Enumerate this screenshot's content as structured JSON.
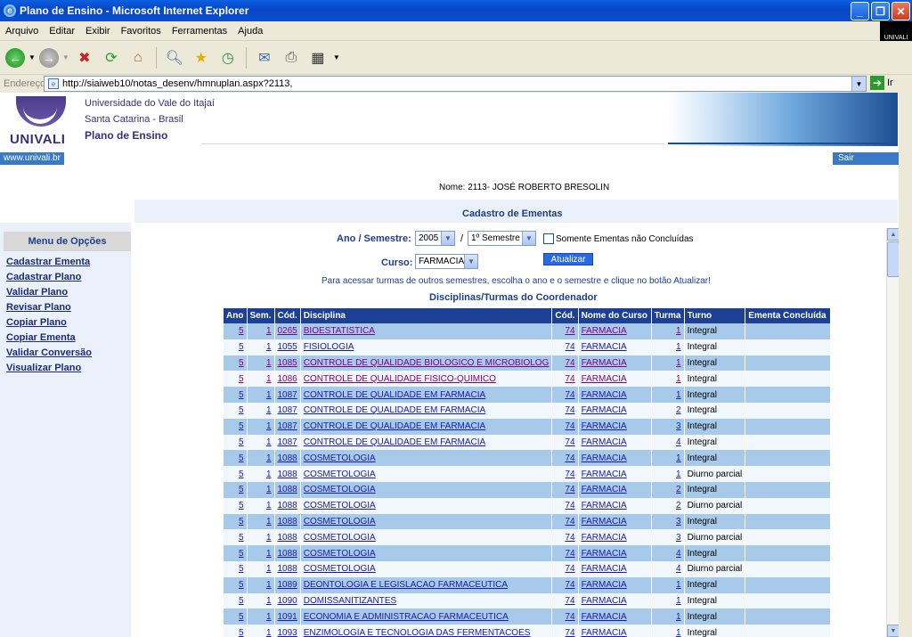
{
  "window": {
    "title": "Plano de Ensino - Microsoft Internet Explorer",
    "min": "_",
    "max": "❐",
    "close": "✕"
  },
  "menubar": [
    "Arquivo",
    "Editar",
    "Exibir",
    "Favoritos",
    "Ferramentas",
    "Ajuda"
  ],
  "windows_logo_text": "UNIVALI",
  "address": {
    "label": "Endereço",
    "url": "http://siaiweb10/notas_desenv/hmnuplan.aspx?2113,",
    "go_label": "Ir"
  },
  "header": {
    "logo_text": "UNIVALI",
    "university": "Universidade do Vale do Itajaí",
    "location": "Santa Catarina - Brasil",
    "title": "Plano de Ensino",
    "site_link": "www.univali.br",
    "logout": "Sair"
  },
  "user_name": "Nome: 2113- JOSÉ ROBERTO BRESOLIN",
  "section_title": "Cadastro de Ementas",
  "sidebar": {
    "heading": "Menu de Opções",
    "items": [
      "Cadastrar Ementa",
      "Cadastrar Plano",
      "Validar Plano",
      "Revisar Plano",
      "Copiar Plano",
      "Copiar Ementa",
      "Validar Conversão",
      "Visualizar Plano"
    ]
  },
  "form": {
    "year_sem_label": "Ano / Semestre:",
    "year": "2005",
    "separator": "/",
    "semester": "1º Semestre",
    "only_pending_label": "Somente Ementas não Concluídas",
    "course_label": "Curso:",
    "course": "FARMACIA",
    "update_button": "Atualizar",
    "help_text": "Para acessar turmas de outros semestres, escolha o ano e o semestre e clique no botão Atualizar!"
  },
  "table": {
    "title": "Disciplinas/Turmas do Coordenador",
    "headers": [
      "Ano",
      "Sem.",
      "Cód.",
      "Disciplina",
      "Cód.",
      "Nome do Curso",
      "Turma",
      "Turno",
      "Ementa Concluída"
    ],
    "rows": [
      [
        "5",
        "1",
        "0265",
        "BIOESTATISTICA",
        "74",
        "FARMACIA",
        "1",
        "Integral",
        ""
      ],
      [
        "5",
        "1",
        "1055",
        "FISIOLOGIA",
        "74",
        "FARMACIA",
        "1",
        "Integral",
        ""
      ],
      [
        "5",
        "1",
        "1085",
        "CONTROLE DE QUALIDADE BIOLOGICO E MICROBIOLOG",
        "74",
        "FARMACIA",
        "1",
        "Integral",
        ""
      ],
      [
        "5",
        "1",
        "1086",
        "CONTROLE DE QUALIDADE FISICO-QUIMICO",
        "74",
        "FARMACIA",
        "1",
        "Integral",
        ""
      ],
      [
        "5",
        "1",
        "1087",
        "CONTROLE DE QUALIDADE EM FARMACIA",
        "74",
        "FARMACIA",
        "1",
        "Integral",
        ""
      ],
      [
        "5",
        "1",
        "1087",
        "CONTROLE DE QUALIDADE EM FARMACIA",
        "74",
        "FARMACIA",
        "2",
        "Integral",
        ""
      ],
      [
        "5",
        "1",
        "1087",
        "CONTROLE DE QUALIDADE EM FARMACIA",
        "74",
        "FARMACIA",
        "3",
        "Integral",
        ""
      ],
      [
        "5",
        "1",
        "1087",
        "CONTROLE DE QUALIDADE EM FARMACIA",
        "74",
        "FARMACIA",
        "4",
        "Integral",
        ""
      ],
      [
        "5",
        "1",
        "1088",
        "COSMETOLOGIA",
        "74",
        "FARMACIA",
        "1",
        "Integral",
        ""
      ],
      [
        "5",
        "1",
        "1088",
        "COSMETOLOGIA",
        "74",
        "FARMACIA",
        "1",
        "Diurno parcial",
        ""
      ],
      [
        "5",
        "1",
        "1088",
        "COSMETOLOGIA",
        "74",
        "FARMACIA",
        "2",
        "Integral",
        ""
      ],
      [
        "5",
        "1",
        "1088",
        "COSMETOLOGIA",
        "74",
        "FARMACIA",
        "2",
        "Diurno parcial",
        ""
      ],
      [
        "5",
        "1",
        "1088",
        "COSMETOLOGIA",
        "74",
        "FARMACIA",
        "3",
        "Integral",
        ""
      ],
      [
        "5",
        "1",
        "1088",
        "COSMETOLOGIA",
        "74",
        "FARMACIA",
        "3",
        "Diurno parcial",
        ""
      ],
      [
        "5",
        "1",
        "1088",
        "COSMETOLOGIA",
        "74",
        "FARMACIA",
        "4",
        "Integral",
        ""
      ],
      [
        "5",
        "1",
        "1088",
        "COSMETOLOGIA",
        "74",
        "FARMACIA",
        "4",
        "Diurno parcial",
        ""
      ],
      [
        "5",
        "1",
        "1089",
        "DEONTOLOGIA E LEGISLACAO FARMACEUTICA",
        "74",
        "FARMACIA",
        "1",
        "Integral",
        ""
      ],
      [
        "5",
        "1",
        "1090",
        "DOMISSANITIZANTES",
        "74",
        "FARMACIA",
        "1",
        "Integral",
        ""
      ],
      [
        "5",
        "1",
        "1091",
        "ECONOMIA E ADMINISTRACAO FARMACEUTICA",
        "74",
        "FARMACIA",
        "1",
        "Integral",
        ""
      ],
      [
        "5",
        "1",
        "1093",
        "ENZIMOLOGIA E TECNOLOGIA DAS FERMENTACOES",
        "74",
        "FARMACIA",
        "1",
        "Integral",
        ""
      ]
    ],
    "visited_rows": [
      0,
      2,
      3
    ]
  },
  "icons": {
    "back": "back-icon",
    "forward": "forward-icon",
    "stop": "stop-icon",
    "refresh": "refresh-icon",
    "home": "home-icon",
    "search": "search-icon",
    "favorites": "favorites-icon",
    "history": "history-icon",
    "mail": "mail-icon",
    "print": "print-icon",
    "edit": "edit-icon"
  }
}
